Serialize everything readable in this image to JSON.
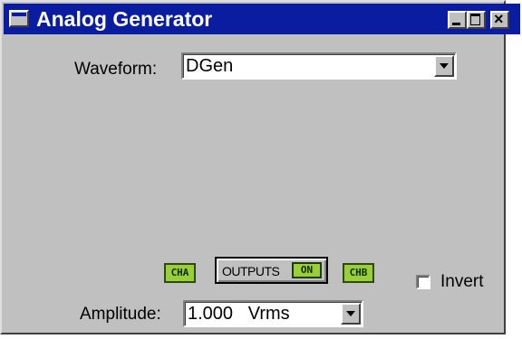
{
  "window": {
    "title": "Analog Generator",
    "title_icon": "window-menu-icon",
    "controls": {
      "minimize": "minimize-icon",
      "maximize": "maximize-icon",
      "close": "close-icon",
      "close_glyph": "×"
    }
  },
  "waveform": {
    "label": "Waveform:",
    "value": "DGen"
  },
  "channels": {
    "cha": "CHA",
    "chb": "CHB"
  },
  "outputs": {
    "label": "OUTPUTS",
    "state": "ON"
  },
  "invert": {
    "label": "Invert",
    "checked": false
  },
  "amplitude": {
    "label": "Amplitude:",
    "value": "1.000   Vrms"
  },
  "colors": {
    "titlebar": "#0a1ca0",
    "panel": "#c0c0c0",
    "led": "#9bcf3a"
  }
}
